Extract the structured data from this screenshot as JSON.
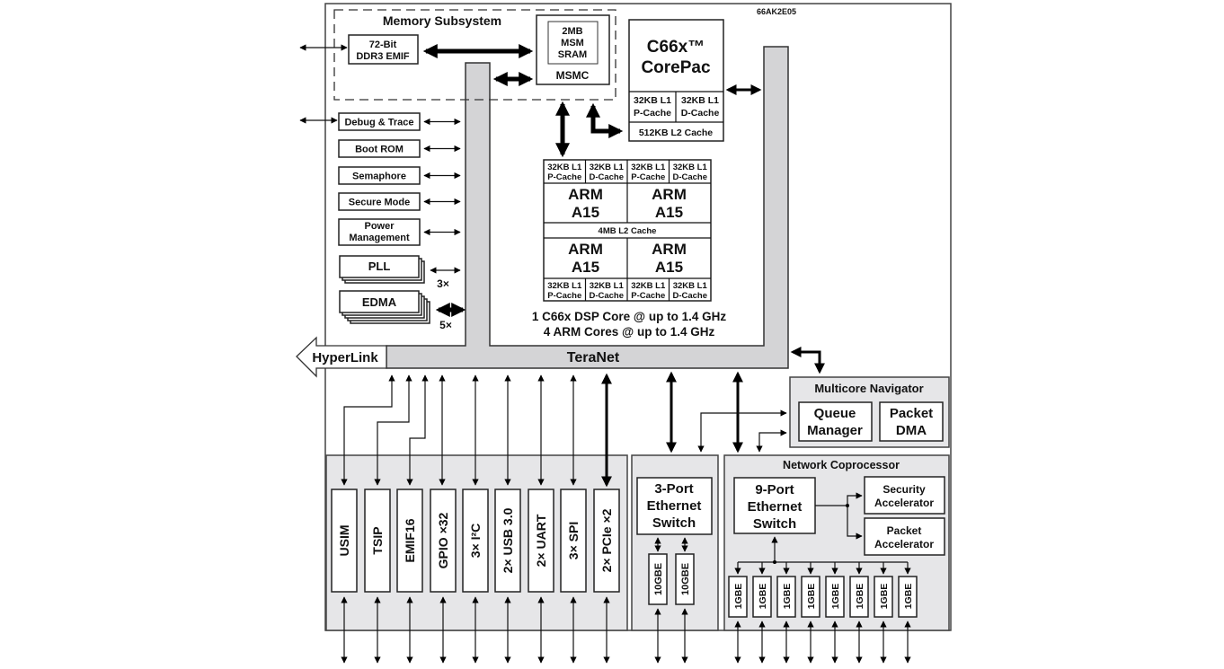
{
  "diagram": {
    "part_number": "66AK2E05",
    "memory_subsystem": {
      "title": "Memory Subsystem",
      "ddr3": [
        "72-Bit",
        "DDR3 EMIF"
      ],
      "msm_sram": [
        "2MB",
        "MSM",
        "SRAM"
      ],
      "msmc": "MSMC"
    },
    "corepac": {
      "title": [
        "C66x™",
        "CorePac"
      ],
      "l1p": [
        "32KB L1",
        "P-Cache"
      ],
      "l1d": [
        "32KB L1",
        "D-Cache"
      ],
      "l2": "512KB L2 Cache"
    },
    "arm_cluster": {
      "core_label": [
        "ARM",
        "A15"
      ],
      "l1p": [
        "32KB L1",
        "P-Cache"
      ],
      "l1d": [
        "32KB L1",
        "D-Cache"
      ],
      "l2": "4MB L2 Cache"
    },
    "peripherals_left": [
      {
        "label": [
          "Debug & Trace"
        ]
      },
      {
        "label": [
          "Boot ROM"
        ]
      },
      {
        "label": [
          "Semaphore"
        ]
      },
      {
        "label": [
          "Secure Mode"
        ]
      },
      {
        "label": [
          "Power",
          "Management"
        ]
      }
    ],
    "pll": {
      "label": "PLL",
      "multiplier": "3×"
    },
    "edma": {
      "label": "EDMA",
      "multiplier": "5×"
    },
    "core_summary": [
      "1 C66x DSP Core @ up to 1.4 GHz",
      "4 ARM Cores @ up to 1.4 GHz"
    ],
    "hyperlink": "HyperLink",
    "teranet": "TeraNet",
    "multicore_navigator": {
      "title": "Multicore Navigator",
      "queue_manager": [
        "Queue",
        "Manager"
      ],
      "packet_dma": [
        "Packet",
        "DMA"
      ]
    },
    "io_blocks": [
      "USIM",
      "TSIP",
      "EMIF16",
      "GPIO ×32",
      "3× I²C",
      "2× USB 3.0",
      "2× UART",
      "3× SPI",
      "2× PCIe ×2"
    ],
    "ethernet_3port": {
      "switch": [
        "3-Port",
        "Ethernet",
        "Switch"
      ],
      "ports": [
        "10GBE",
        "10GBE"
      ]
    },
    "network_coprocessor": {
      "title": "Network Coprocessor",
      "switch": [
        "9-Port",
        "Ethernet",
        "Switch"
      ],
      "security": [
        "Security",
        "Accelerator"
      ],
      "packet": [
        "Packet",
        "Accelerator"
      ],
      "ports": [
        "1GBE",
        "1GBE",
        "1GBE",
        "1GBE",
        "1GBE",
        "1GBE",
        "1GBE",
        "1GBE"
      ]
    }
  }
}
